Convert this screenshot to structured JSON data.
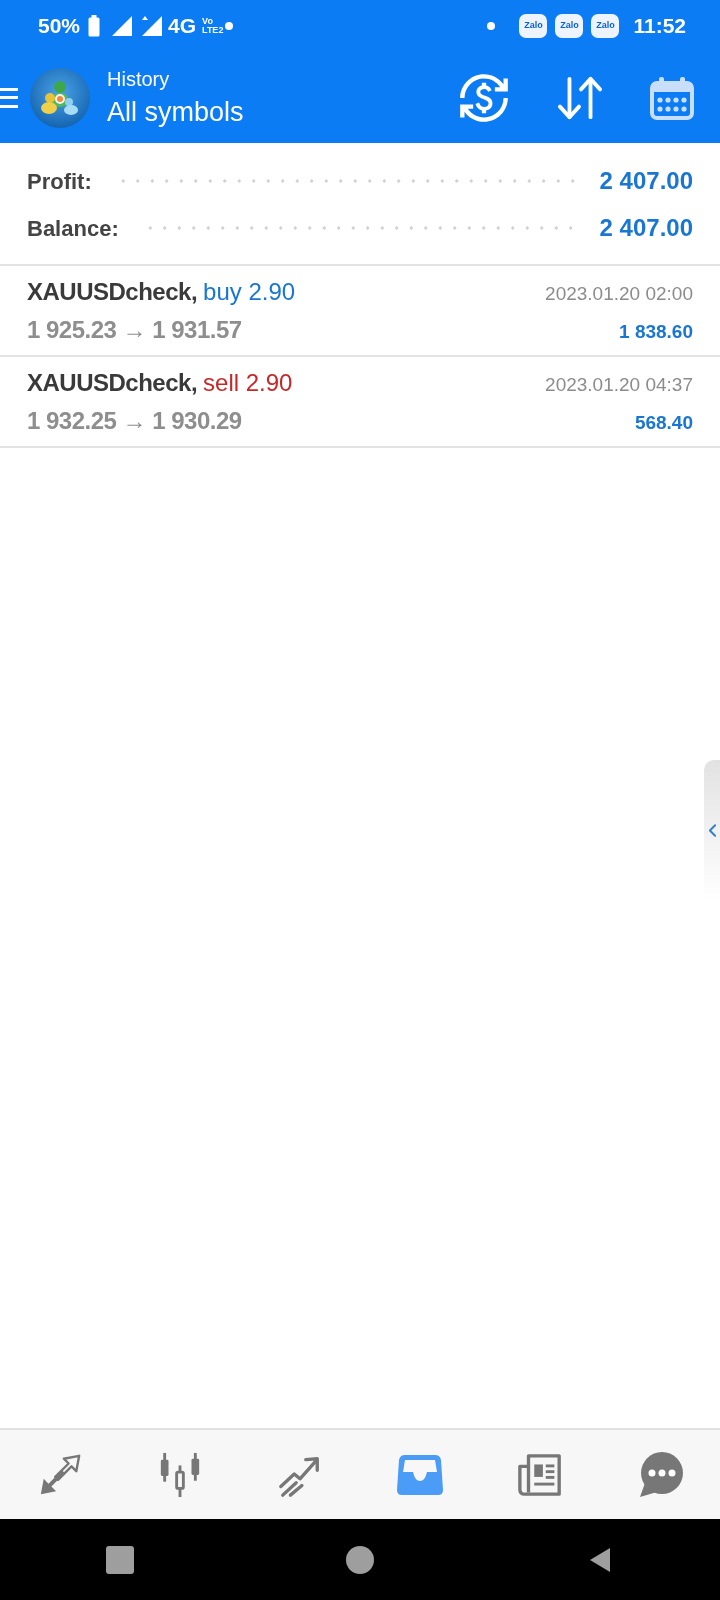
{
  "status_bar": {
    "battery": "50%",
    "network": "4G",
    "volte_top": "Vo",
    "volte_bottom": "LTE2",
    "notification_icons": [
      {
        "label": "Zalo"
      },
      {
        "label": "Zalo"
      },
      {
        "label": "Zalo"
      }
    ],
    "time": "11:52"
  },
  "header": {
    "title": "History",
    "subtitle": "All symbols"
  },
  "summary": [
    {
      "label": "Profit:",
      "value": "2 407.00"
    },
    {
      "label": "Balance:",
      "value": "2 407.00"
    }
  ],
  "deals": [
    {
      "symbol": "XAUUSDcheck,",
      "kind": "buy",
      "action": "buy 2.90",
      "prices": "1 925.23 → 1 931.57",
      "time": "2023.01.20 02:00",
      "profit": "1 838.60"
    },
    {
      "symbol": "XAUUSDcheck,",
      "kind": "sell",
      "action": "sell 2.90",
      "prices": "1 932.25 → 1 930.29",
      "time": "2023.01.20 04:37",
      "profit": "568.40"
    }
  ],
  "bottom_tabs": [
    {
      "selected": false
    },
    {
      "selected": false
    },
    {
      "selected": false
    },
    {
      "selected": true
    },
    {
      "selected": false
    },
    {
      "selected": false
    }
  ]
}
